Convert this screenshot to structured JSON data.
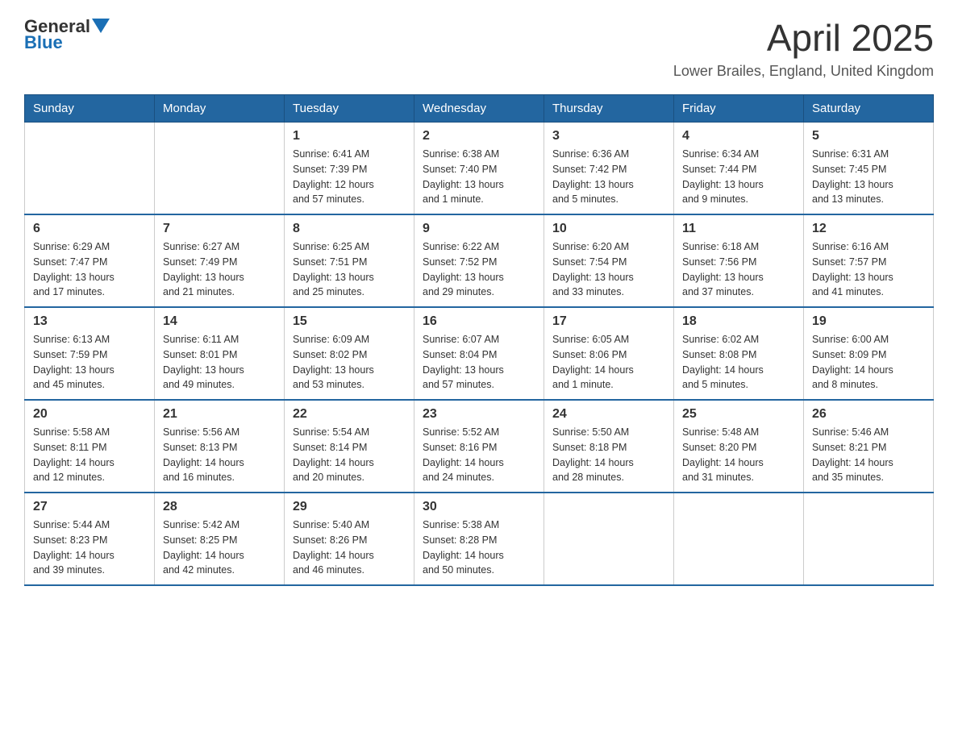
{
  "header": {
    "logo_general": "General",
    "logo_blue": "Blue",
    "title": "April 2025",
    "subtitle": "Lower Brailes, England, United Kingdom"
  },
  "days_of_week": [
    "Sunday",
    "Monday",
    "Tuesday",
    "Wednesday",
    "Thursday",
    "Friday",
    "Saturday"
  ],
  "weeks": [
    [
      {
        "day": "",
        "info": ""
      },
      {
        "day": "",
        "info": ""
      },
      {
        "day": "1",
        "info": "Sunrise: 6:41 AM\nSunset: 7:39 PM\nDaylight: 12 hours\nand 57 minutes."
      },
      {
        "day": "2",
        "info": "Sunrise: 6:38 AM\nSunset: 7:40 PM\nDaylight: 13 hours\nand 1 minute."
      },
      {
        "day": "3",
        "info": "Sunrise: 6:36 AM\nSunset: 7:42 PM\nDaylight: 13 hours\nand 5 minutes."
      },
      {
        "day": "4",
        "info": "Sunrise: 6:34 AM\nSunset: 7:44 PM\nDaylight: 13 hours\nand 9 minutes."
      },
      {
        "day": "5",
        "info": "Sunrise: 6:31 AM\nSunset: 7:45 PM\nDaylight: 13 hours\nand 13 minutes."
      }
    ],
    [
      {
        "day": "6",
        "info": "Sunrise: 6:29 AM\nSunset: 7:47 PM\nDaylight: 13 hours\nand 17 minutes."
      },
      {
        "day": "7",
        "info": "Sunrise: 6:27 AM\nSunset: 7:49 PM\nDaylight: 13 hours\nand 21 minutes."
      },
      {
        "day": "8",
        "info": "Sunrise: 6:25 AM\nSunset: 7:51 PM\nDaylight: 13 hours\nand 25 minutes."
      },
      {
        "day": "9",
        "info": "Sunrise: 6:22 AM\nSunset: 7:52 PM\nDaylight: 13 hours\nand 29 minutes."
      },
      {
        "day": "10",
        "info": "Sunrise: 6:20 AM\nSunset: 7:54 PM\nDaylight: 13 hours\nand 33 minutes."
      },
      {
        "day": "11",
        "info": "Sunrise: 6:18 AM\nSunset: 7:56 PM\nDaylight: 13 hours\nand 37 minutes."
      },
      {
        "day": "12",
        "info": "Sunrise: 6:16 AM\nSunset: 7:57 PM\nDaylight: 13 hours\nand 41 minutes."
      }
    ],
    [
      {
        "day": "13",
        "info": "Sunrise: 6:13 AM\nSunset: 7:59 PM\nDaylight: 13 hours\nand 45 minutes."
      },
      {
        "day": "14",
        "info": "Sunrise: 6:11 AM\nSunset: 8:01 PM\nDaylight: 13 hours\nand 49 minutes."
      },
      {
        "day": "15",
        "info": "Sunrise: 6:09 AM\nSunset: 8:02 PM\nDaylight: 13 hours\nand 53 minutes."
      },
      {
        "day": "16",
        "info": "Sunrise: 6:07 AM\nSunset: 8:04 PM\nDaylight: 13 hours\nand 57 minutes."
      },
      {
        "day": "17",
        "info": "Sunrise: 6:05 AM\nSunset: 8:06 PM\nDaylight: 14 hours\nand 1 minute."
      },
      {
        "day": "18",
        "info": "Sunrise: 6:02 AM\nSunset: 8:08 PM\nDaylight: 14 hours\nand 5 minutes."
      },
      {
        "day": "19",
        "info": "Sunrise: 6:00 AM\nSunset: 8:09 PM\nDaylight: 14 hours\nand 8 minutes."
      }
    ],
    [
      {
        "day": "20",
        "info": "Sunrise: 5:58 AM\nSunset: 8:11 PM\nDaylight: 14 hours\nand 12 minutes."
      },
      {
        "day": "21",
        "info": "Sunrise: 5:56 AM\nSunset: 8:13 PM\nDaylight: 14 hours\nand 16 minutes."
      },
      {
        "day": "22",
        "info": "Sunrise: 5:54 AM\nSunset: 8:14 PM\nDaylight: 14 hours\nand 20 minutes."
      },
      {
        "day": "23",
        "info": "Sunrise: 5:52 AM\nSunset: 8:16 PM\nDaylight: 14 hours\nand 24 minutes."
      },
      {
        "day": "24",
        "info": "Sunrise: 5:50 AM\nSunset: 8:18 PM\nDaylight: 14 hours\nand 28 minutes."
      },
      {
        "day": "25",
        "info": "Sunrise: 5:48 AM\nSunset: 8:20 PM\nDaylight: 14 hours\nand 31 minutes."
      },
      {
        "day": "26",
        "info": "Sunrise: 5:46 AM\nSunset: 8:21 PM\nDaylight: 14 hours\nand 35 minutes."
      }
    ],
    [
      {
        "day": "27",
        "info": "Sunrise: 5:44 AM\nSunset: 8:23 PM\nDaylight: 14 hours\nand 39 minutes."
      },
      {
        "day": "28",
        "info": "Sunrise: 5:42 AM\nSunset: 8:25 PM\nDaylight: 14 hours\nand 42 minutes."
      },
      {
        "day": "29",
        "info": "Sunrise: 5:40 AM\nSunset: 8:26 PM\nDaylight: 14 hours\nand 46 minutes."
      },
      {
        "day": "30",
        "info": "Sunrise: 5:38 AM\nSunset: 8:28 PM\nDaylight: 14 hours\nand 50 minutes."
      },
      {
        "day": "",
        "info": ""
      },
      {
        "day": "",
        "info": ""
      },
      {
        "day": "",
        "info": ""
      }
    ]
  ]
}
